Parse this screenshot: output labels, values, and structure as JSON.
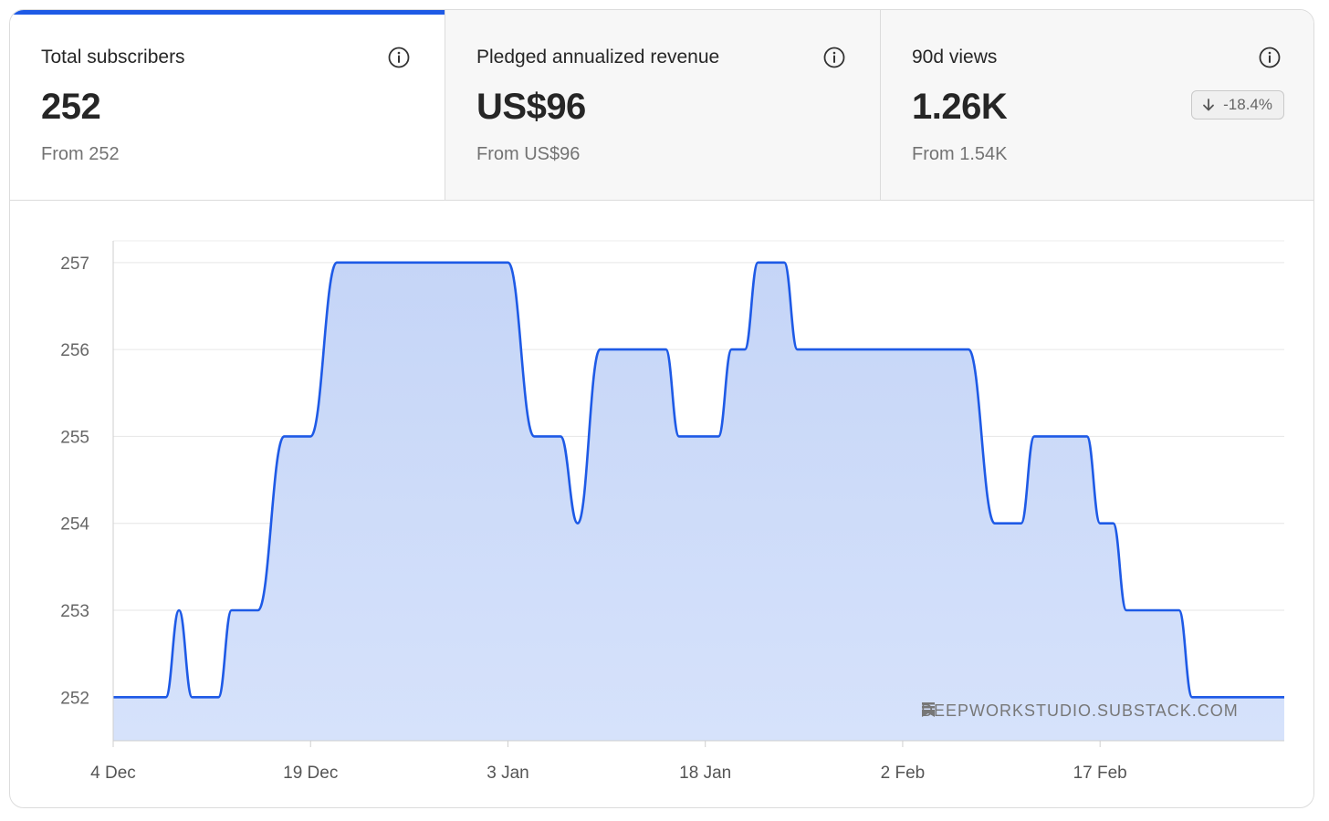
{
  "tabs": [
    {
      "label": "Total subscribers",
      "value": "252",
      "from": "From 252",
      "active": true
    },
    {
      "label": "Pledged annualized revenue",
      "value": "US$96",
      "from": "From US$96",
      "active": false
    },
    {
      "label": "90d views",
      "value": "1.26K",
      "from": "From 1.54K",
      "active": false,
      "change": "-18.4%"
    }
  ],
  "icons": {
    "info": "info-circle-icon",
    "change": "arrow-down-icon",
    "watermark": "bookmark-icon"
  },
  "colors": {
    "accent": "#1e5ae6",
    "fill": "#c9d8f8"
  },
  "watermark": "DEEPWORKSTUDIO.SUBSTACK.COM",
  "chart_data": {
    "type": "area",
    "title": "",
    "xlabel": "",
    "ylabel": "",
    "ylim": [
      251.5,
      257.25
    ],
    "yticks": [
      252,
      253,
      254,
      255,
      256,
      257
    ],
    "xticks": [
      "4 Dec",
      "19 Dec",
      "3 Jan",
      "18 Jan",
      "2 Feb",
      "17 Feb"
    ],
    "xrange": [
      0,
      89
    ],
    "grid": true,
    "legend": "none",
    "series": [
      {
        "values": [
          [
            0,
            252
          ],
          [
            4,
            252
          ],
          [
            5,
            253
          ],
          [
            6,
            252
          ],
          [
            8,
            252
          ],
          [
            9,
            253
          ],
          [
            11,
            253
          ],
          [
            13,
            255
          ],
          [
            15,
            255
          ],
          [
            17,
            257
          ],
          [
            30,
            257
          ],
          [
            32,
            255
          ],
          [
            34,
            255
          ],
          [
            35.3,
            254
          ],
          [
            37,
            256
          ],
          [
            42,
            256
          ],
          [
            43,
            255
          ],
          [
            46,
            255
          ],
          [
            47,
            256
          ],
          [
            48,
            256
          ],
          [
            49,
            257
          ],
          [
            51,
            257
          ],
          [
            52,
            256
          ],
          [
            65,
            256
          ],
          [
            67,
            254
          ],
          [
            69,
            254
          ],
          [
            70,
            255
          ],
          [
            74,
            255
          ],
          [
            75,
            254
          ],
          [
            76,
            254
          ],
          [
            77,
            253
          ],
          [
            81,
            253
          ],
          [
            82,
            252
          ],
          [
            89,
            252
          ]
        ]
      }
    ]
  }
}
